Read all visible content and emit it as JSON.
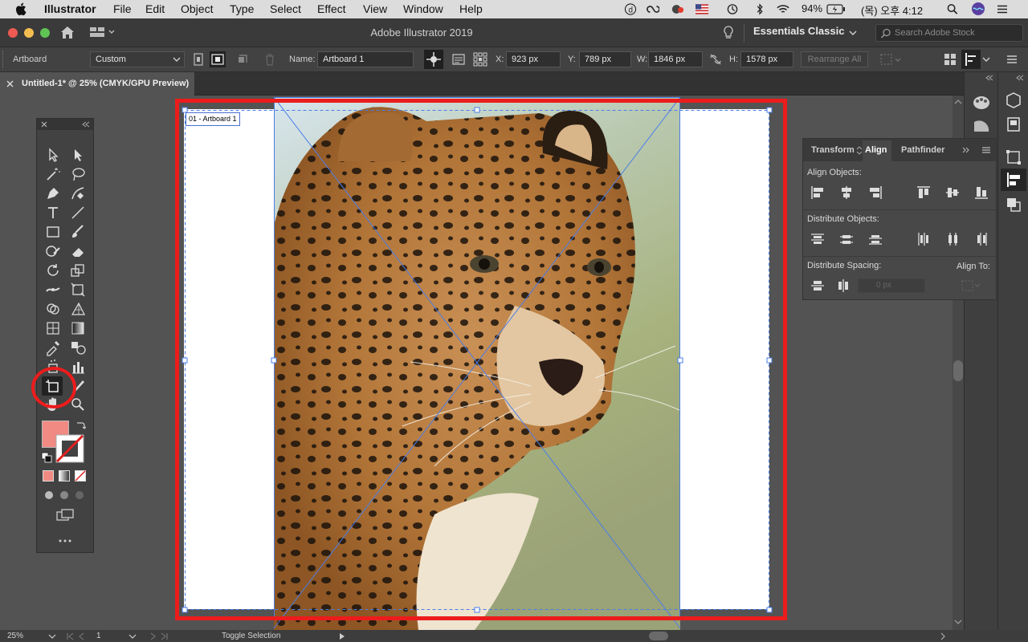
{
  "menubar": {
    "app_name": "Illustrator",
    "menus": [
      "File",
      "Edit",
      "Object",
      "Type",
      "Select",
      "Effect",
      "View",
      "Window",
      "Help"
    ],
    "battery": "94%",
    "datetime": "(목) 오후 4:12"
  },
  "titlebar": {
    "app_title": "Adobe Illustrator 2019",
    "workspace": "Essentials Classic",
    "search_placeholder": "Search Adobe Stock"
  },
  "control_bar": {
    "mode_label": "Artboard",
    "preset_value": "Custom",
    "name_label": "Name:",
    "name_value": "Artboard 1",
    "x_label": "X:",
    "x_value": "923 px",
    "y_label": "Y:",
    "y_value": "789 px",
    "w_label": "W:",
    "w_value": "1846 px",
    "h_label": "H:",
    "h_value": "1578 px",
    "rearrange_label": "Rearrange All"
  },
  "document_tab": {
    "title": "Untitled-1* @ 25% (CMYK/GPU Preview)"
  },
  "canvas": {
    "artboard_label": "01 - Artboard 1"
  },
  "align_panel": {
    "tabs": [
      "Transform",
      "Align",
      "Pathfinder"
    ],
    "active_tab": "Align",
    "align_objects_label": "Align Objects:",
    "distribute_objects_label": "Distribute Objects:",
    "distribute_spacing_label": "Distribute Spacing:",
    "align_to_label": "Align To:",
    "spacing_value": "0 px"
  },
  "status_bar": {
    "zoom": "25%",
    "artboard_number": "1",
    "toggle_label": "Toggle Selection"
  },
  "colors": {
    "fill_swatch": "#f08a82",
    "annotation_red": "#ec1c1c"
  }
}
